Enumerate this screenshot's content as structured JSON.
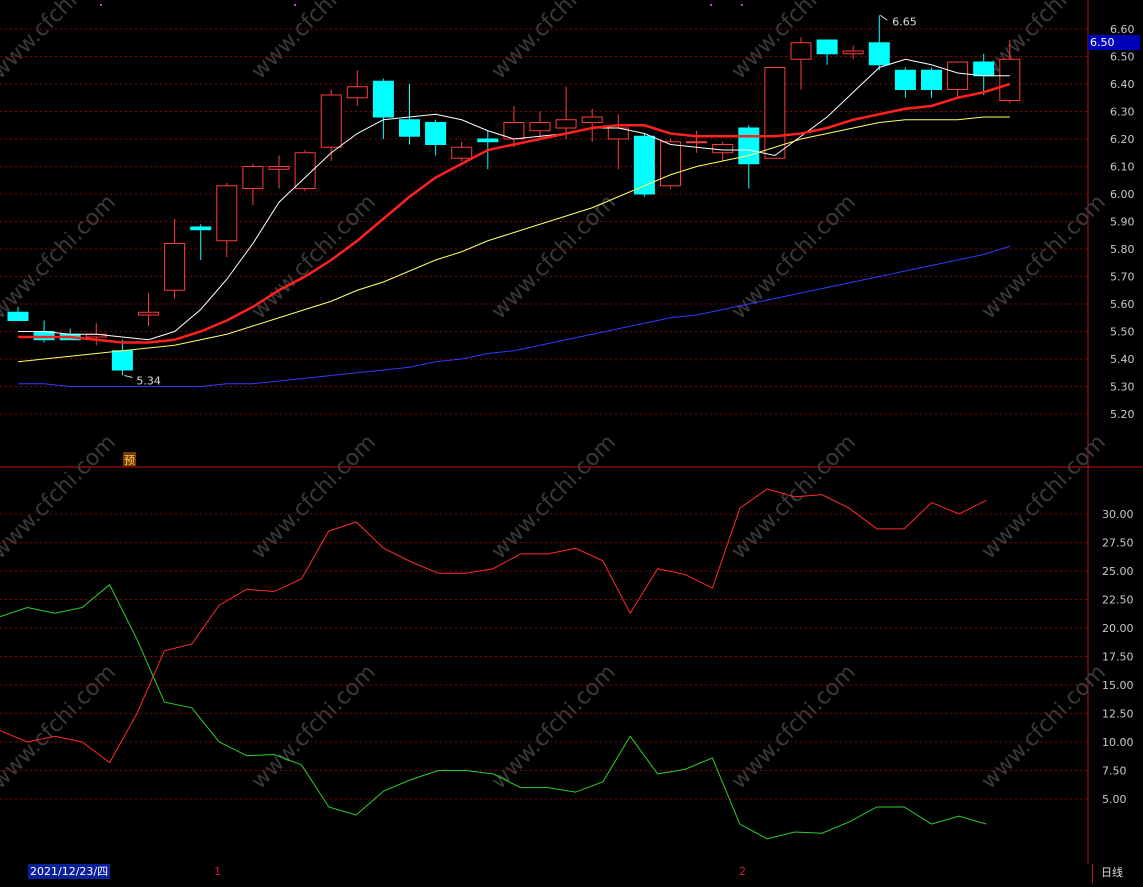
{
  "colors": {
    "up": "#ff3b3b",
    "down": "#00ffff",
    "ma5": "#ffffff",
    "ma10": "#ff2020",
    "ma20": "#ffff66",
    "ma60": "#2e3cff",
    "indicator_up": "#ff2a2a",
    "indicator_down": "#2ecc2e",
    "grid": "#8b0000",
    "axis_text": "#c8c8c8",
    "watermark": "#3a3a3a"
  },
  "main": {
    "high_label": "6.65",
    "low_label": "5.34",
    "forecast_badge": "预",
    "current_price_tag": "6.50"
  },
  "bottom_bar": {
    "date": "2021/12/23/四",
    "month_markers": [
      "1",
      "2"
    ],
    "period": "日线"
  },
  "watermark": "www.cfchi.com",
  "chart_data": [
    {
      "type": "candlestick",
      "y_ticks": [
        "6.60",
        "6.50",
        "6.40",
        "6.30",
        "6.20",
        "6.10",
        "6.00",
        "5.90",
        "5.80",
        "5.70",
        "5.60",
        "5.50",
        "5.40",
        "5.30",
        "5.20"
      ],
      "ylim": [
        5.12,
        6.64
      ],
      "grid": true,
      "candles": [
        {
          "o": 5.57,
          "h": 5.59,
          "l": 5.54,
          "c": 5.54
        },
        {
          "o": 5.5,
          "h": 5.54,
          "l": 5.46,
          "c": 5.47
        },
        {
          "o": 5.49,
          "h": 5.51,
          "l": 5.47,
          "c": 5.47
        },
        {
          "o": 5.48,
          "h": 5.53,
          "l": 5.45,
          "c": 5.49
        },
        {
          "o": 5.43,
          "h": 5.47,
          "l": 5.34,
          "c": 5.36
        },
        {
          "o": 5.56,
          "h": 5.64,
          "l": 5.52,
          "c": 5.57
        },
        {
          "o": 5.65,
          "h": 5.91,
          "l": 5.62,
          "c": 5.82
        },
        {
          "o": 5.88,
          "h": 5.89,
          "l": 5.76,
          "c": 5.87
        },
        {
          "o": 5.83,
          "h": 6.04,
          "l": 5.77,
          "c": 6.03
        },
        {
          "o": 6.02,
          "h": 6.11,
          "l": 5.96,
          "c": 6.1
        },
        {
          "o": 6.09,
          "h": 6.14,
          "l": 6.02,
          "c": 6.1
        },
        {
          "o": 6.02,
          "h": 6.16,
          "l": 6.01,
          "c": 6.15
        },
        {
          "o": 6.17,
          "h": 6.38,
          "l": 6.12,
          "c": 6.36
        },
        {
          "o": 6.35,
          "h": 6.45,
          "l": 6.32,
          "c": 6.39
        },
        {
          "o": 6.41,
          "h": 6.42,
          "l": 6.2,
          "c": 6.28
        },
        {
          "o": 6.27,
          "h": 6.4,
          "l": 6.18,
          "c": 6.21
        },
        {
          "o": 6.26,
          "h": 6.27,
          "l": 6.14,
          "c": 6.18
        },
        {
          "o": 6.13,
          "h": 6.19,
          "l": 6.12,
          "c": 6.17
        },
        {
          "o": 6.2,
          "h": 6.23,
          "l": 6.09,
          "c": 6.19
        },
        {
          "o": 6.2,
          "h": 6.32,
          "l": 6.17,
          "c": 6.26
        },
        {
          "o": 6.23,
          "h": 6.3,
          "l": 6.2,
          "c": 6.26
        },
        {
          "o": 6.24,
          "h": 6.39,
          "l": 6.2,
          "c": 6.27
        },
        {
          "o": 6.26,
          "h": 6.31,
          "l": 6.19,
          "c": 6.28
        },
        {
          "o": 6.2,
          "h": 6.29,
          "l": 6.09,
          "c": 6.24
        },
        {
          "o": 6.21,
          "h": 6.22,
          "l": 5.99,
          "c": 6.0
        },
        {
          "o": 6.03,
          "h": 6.2,
          "l": 6.02,
          "c": 6.19
        },
        {
          "o": 6.19,
          "h": 6.23,
          "l": 6.15,
          "c": 6.19
        },
        {
          "o": 6.15,
          "h": 6.19,
          "l": 6.12,
          "c": 6.18
        },
        {
          "o": 6.24,
          "h": 6.25,
          "l": 6.02,
          "c": 6.11
        },
        {
          "o": 6.13,
          "h": 6.46,
          "l": 6.13,
          "c": 6.46
        },
        {
          "o": 6.49,
          "h": 6.57,
          "l": 6.38,
          "c": 6.55
        },
        {
          "o": 6.56,
          "h": 6.56,
          "l": 6.47,
          "c": 6.51
        },
        {
          "o": 6.51,
          "h": 6.54,
          "l": 6.49,
          "c": 6.52
        },
        {
          "o": 6.55,
          "h": 6.65,
          "l": 6.45,
          "c": 6.47
        },
        {
          "o": 6.45,
          "h": 6.46,
          "l": 6.35,
          "c": 6.38
        },
        {
          "o": 6.45,
          "h": 6.46,
          "l": 6.35,
          "c": 6.38
        },
        {
          "o": 6.38,
          "h": 6.48,
          "l": 6.35,
          "c": 6.48
        },
        {
          "o": 6.48,
          "h": 6.51,
          "l": 6.36,
          "c": 6.43
        },
        {
          "o": 6.34,
          "h": 6.56,
          "l": 6.33,
          "c": 6.49
        }
      ],
      "ma": [
        {
          "name": "MA5",
          "color": "#ffffff",
          "width": 1,
          "values": [
            5.5,
            5.5,
            5.49,
            5.49,
            5.48,
            5.47,
            5.5,
            5.58,
            5.69,
            5.82,
            5.97,
            6.06,
            6.15,
            6.22,
            6.27,
            6.28,
            6.29,
            6.27,
            6.23,
            6.2,
            6.21,
            6.22,
            6.24,
            6.24,
            6.22,
            6.18,
            6.17,
            6.16,
            6.16,
            6.14,
            6.21,
            6.28,
            6.37,
            6.46,
            6.49,
            6.47,
            6.44,
            6.43,
            6.43
          ]
        },
        {
          "name": "MA10",
          "color": "#ff2020",
          "width": 2.5,
          "values": [
            5.48,
            5.48,
            5.48,
            5.47,
            5.46,
            5.46,
            5.47,
            5.5,
            5.54,
            5.59,
            5.65,
            5.7,
            5.76,
            5.83,
            5.91,
            5.99,
            6.06,
            6.11,
            6.16,
            6.18,
            6.2,
            6.22,
            6.24,
            6.25,
            6.25,
            6.22,
            6.21,
            6.21,
            6.21,
            6.21,
            6.22,
            6.24,
            6.27,
            6.29,
            6.31,
            6.32,
            6.35,
            6.37,
            6.4
          ]
        },
        {
          "name": "MA20",
          "color": "#ffff66",
          "width": 1,
          "values": [
            5.39,
            5.4,
            5.41,
            5.42,
            5.43,
            5.44,
            5.45,
            5.47,
            5.49,
            5.52,
            5.55,
            5.58,
            5.61,
            5.65,
            5.68,
            5.72,
            5.76,
            5.79,
            5.83,
            5.86,
            5.89,
            5.92,
            5.95,
            5.99,
            6.03,
            6.07,
            6.1,
            6.12,
            6.14,
            6.17,
            6.2,
            6.22,
            6.24,
            6.26,
            6.27,
            6.27,
            6.27,
            6.28,
            6.28
          ]
        },
        {
          "name": "MA60",
          "color": "#2e3cff",
          "width": 1,
          "values": [
            5.31,
            5.31,
            5.3,
            5.3,
            5.3,
            5.3,
            5.3,
            5.3,
            5.31,
            5.31,
            5.32,
            5.33,
            5.34,
            5.35,
            5.36,
            5.37,
            5.39,
            5.4,
            5.42,
            5.43,
            5.45,
            5.47,
            5.49,
            5.51,
            5.53,
            5.55,
            5.56,
            5.58,
            5.6,
            5.62,
            5.64,
            5.66,
            5.68,
            5.7,
            5.72,
            5.74,
            5.76,
            5.78,
            5.81
          ]
        }
      ]
    },
    {
      "type": "line",
      "y_ticks": [
        "30.00",
        "27.50",
        "25.00",
        "22.50",
        "20.00",
        "17.50",
        "15.00",
        "12.50",
        "10.00",
        "7.50",
        "5.00"
      ],
      "ylim": [
        1.0,
        34.0
      ],
      "grid": true,
      "series": [
        {
          "color": "#ff2a2a",
          "values": [
            11.0,
            10.0,
            10.5,
            10.0,
            8.2,
            12.5,
            18.0,
            18.6,
            22.0,
            23.4,
            23.2,
            24.3,
            28.5,
            29.3,
            27.0,
            25.8,
            24.8,
            24.8,
            25.2,
            26.5,
            26.5,
            27.0,
            25.9,
            21.3,
            25.2,
            24.7,
            23.5,
            30.5,
            32.2,
            31.5,
            31.7,
            30.5,
            28.7,
            28.7,
            31.0,
            30.0,
            31.2
          ]
        },
        {
          "color": "#2ecc2e",
          "values": [
            21.0,
            21.8,
            21.3,
            21.8,
            23.8,
            19.0,
            13.5,
            13.0,
            10.0,
            8.8,
            8.9,
            8.0,
            4.3,
            3.6,
            5.7,
            6.7,
            7.5,
            7.5,
            7.2,
            6.0,
            6.0,
            5.6,
            6.5,
            10.5,
            7.2,
            7.6,
            8.6,
            2.8,
            1.5,
            2.1,
            2.0,
            3.0,
            4.3,
            4.3,
            2.8,
            3.5,
            2.8
          ]
        }
      ]
    }
  ]
}
